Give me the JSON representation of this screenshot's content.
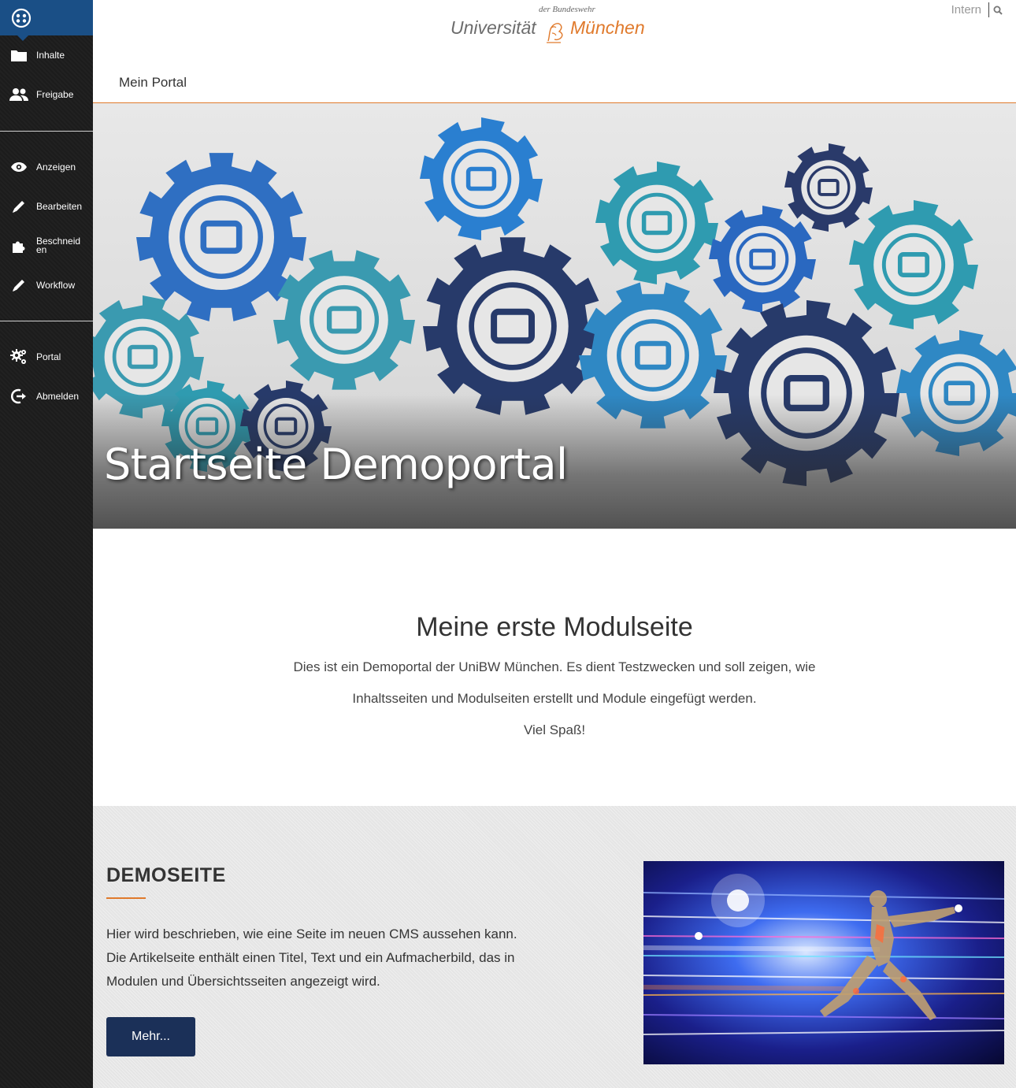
{
  "sidebar": {
    "group1": [
      {
        "label": "Inhalte",
        "icon": "folder-icon"
      },
      {
        "label": "Freigabe",
        "icon": "users-icon"
      }
    ],
    "group2": [
      {
        "label": "Anzeigen",
        "icon": "eye-icon"
      },
      {
        "label": "Bearbeiten",
        "icon": "pencil-icon"
      },
      {
        "label": "Beschneiden",
        "icon": "puzzle-icon"
      },
      {
        "label": "Workflow",
        "icon": "pencil-icon"
      }
    ],
    "group3": [
      {
        "label": "Portal",
        "icon": "gears-icon"
      },
      {
        "label": "Abmelden",
        "icon": "logout-icon"
      }
    ]
  },
  "header": {
    "logo_small": "der Bundeswehr",
    "logo_left": "Universität",
    "logo_right": "München",
    "intern": "Intern",
    "nav": "Mein Portal"
  },
  "hero": {
    "title": "Startseite Demoportal"
  },
  "intro": {
    "heading": "Meine erste Modulseite",
    "line1": "Dies ist ein Demoportal der UniBW München. Es dient Testzwecken und soll zeigen, wie",
    "line2": "Inhaltsseiten und Modulseiten erstellt und Module eingefügt werden.",
    "line3": "Viel Spaß!"
  },
  "demo": {
    "heading": "DEMOSEITE",
    "line1": "Hier wird beschrieben, wie eine Seite im neuen CMS aussehen kann.",
    "line2": "Die Artikelseite enthält einen Titel, Text und ein Aufmacherbild, das in",
    "line3": "Modulen und Übersichtsseiten angezeigt wird.",
    "button": "Mehr..."
  },
  "colors": {
    "accent": "#e07a2c",
    "sidebar_top": "#1a4f86",
    "button": "#1b3058"
  }
}
